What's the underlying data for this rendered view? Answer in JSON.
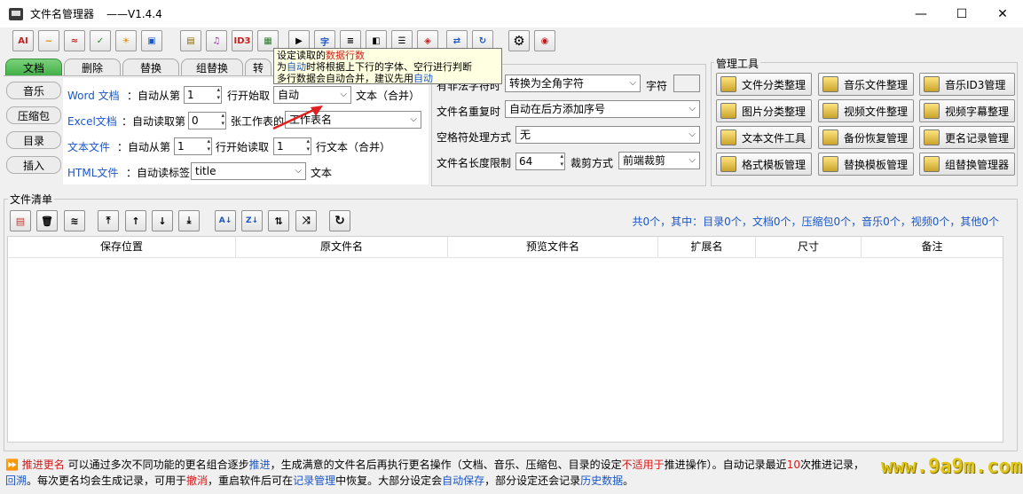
{
  "window": {
    "title": "文件名管理器",
    "version": "——V1.4.4"
  },
  "main_tabs": [
    "文档",
    "删除",
    "替换",
    "组替换",
    "转"
  ],
  "side_tabs": [
    "音乐",
    "压缩包",
    "目录",
    "插入"
  ],
  "doc": {
    "word_label": "Word 文档",
    "word_auto_from": "：自动从第",
    "word_start": "1",
    "word_row_start": "行开始取",
    "word_mode": "自动",
    "word_tail": "文本（合并）",
    "excel_label": "Excel文档",
    "excel_auto_read": "：自动读取第",
    "excel_sheet": "0",
    "excel_sheet_of": "张工作表的",
    "excel_sheet_name": "工作表名",
    "text_label": "文本文件",
    "text_auto_from": "：自动从第",
    "text_start": "1",
    "text_row_start": "行开始读取",
    "text_rows": "1",
    "text_tail": "行文本（合并）",
    "html_label": "HTML文件",
    "html_auto_tag": "：自动读标签",
    "html_tag": "title",
    "html_tail": "文本"
  },
  "options": {
    "illegal_label": "有非法字符时",
    "illegal_value": "转换为全角字符",
    "char_label": "字符",
    "dup_label": "文件名重复时",
    "dup_value": "自动在后方添加序号",
    "space_label": "空格符处理方式",
    "space_value": "无",
    "len_label": "文件名长度限制",
    "len_value": "64",
    "cut_label": "裁剪方式",
    "cut_value": "前端裁剪"
  },
  "tools": {
    "title": "管理工具",
    "buttons": [
      "文件分类整理",
      "音乐文件整理",
      "音乐ID3管理",
      "图片分类整理",
      "视频文件整理",
      "视频字幕整理",
      "文本文件工具",
      "备份恢复管理",
      "更名记录管理",
      "格式模板管理",
      "替换模板管理",
      "组替换管理器"
    ]
  },
  "filelist": {
    "title": "文件清单",
    "stats": "共0个，其中：目录0个，文档0个，压缩包0个，音乐0个，视频0个，其他0个",
    "columns": [
      "保存位置",
      "原文件名",
      "预览文件名",
      "扩展名",
      "尺寸",
      "备注"
    ]
  },
  "tooltip": {
    "l1a": "设定读取的",
    "l1b": "数据行数",
    "l2a": "为",
    "l2b": "自动",
    "l2c": "时将根据上下行的字体、空行进行判断",
    "l3a": "多行数据会自动合并，建议先用",
    "l3b": "自动"
  },
  "status": {
    "s1": "推进更名",
    "s2": " 可以通过多次不同功能的更名组合逐步",
    "s3": "推进",
    "s4": "，生成满意的文件名后再执行更名操作（文档、音乐、压缩包、目录的设定",
    "s5": "不适用于",
    "s6": "推进操作）。自动记录最近",
    "s7": "10",
    "s8": "次推进记录，",
    "s9": "回溯",
    "s10": "。每次更名均会生成记录，可用于",
    "s11": "撤消",
    "s12": "，重启软件后可在",
    "s13": "记录管理",
    "s14": "中恢复。大部分设定会",
    "s15": "自动保存",
    "s16": "，部分设定还会记录",
    "s17": "历史数据",
    "s18": "。"
  },
  "watermark": "www.9a9m.com",
  "colors": {
    "accent_green": "#3fae45",
    "link_blue": "#1c56c4",
    "highlight_red": "#d11c1c"
  }
}
